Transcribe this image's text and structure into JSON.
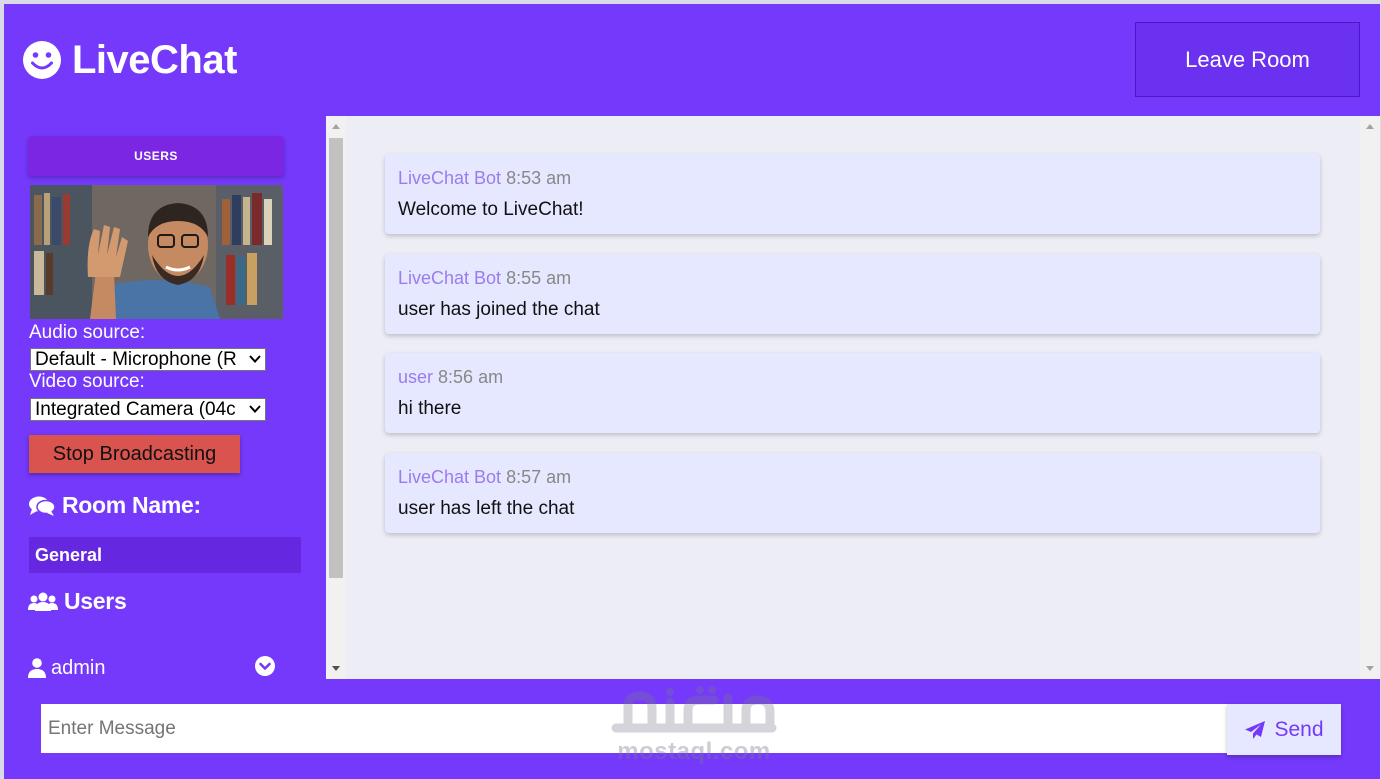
{
  "header": {
    "logo_text": "LiveChat",
    "logo_icon": "smiley-icon",
    "leave_label": "Leave Room"
  },
  "sidebar": {
    "users_pill": "USERS",
    "audio_label": "Audio source:",
    "audio_value": "Default - Microphone (R",
    "video_label": "Video source:",
    "video_value": "Integrated Camera (04c",
    "stop_label": "Stop Broadcasting",
    "room_title": "Room Name:",
    "room_name": "General",
    "users_title": "Users",
    "users": [
      {
        "name": "admin",
        "icon": "user-icon"
      }
    ]
  },
  "messages": [
    {
      "author": "LiveChat Bot",
      "time": "8:53 am",
      "text": "Welcome to LiveChat!"
    },
    {
      "author": "LiveChat Bot",
      "time": "8:55 am",
      "text": "user has joined the chat"
    },
    {
      "author": "user",
      "time": "8:56 am",
      "text": "hi there"
    },
    {
      "author": "LiveChat Bot",
      "time": "8:57 am",
      "text": "user has left the chat"
    }
  ],
  "footer": {
    "placeholder": "Enter Message",
    "send_label": "Send"
  },
  "watermark": {
    "text": "mostaql.com"
  },
  "colors": {
    "brand": "#7439fa",
    "stop": "#d9534f",
    "bubble": "#e6e8ff",
    "author": "#9b7bf0"
  }
}
